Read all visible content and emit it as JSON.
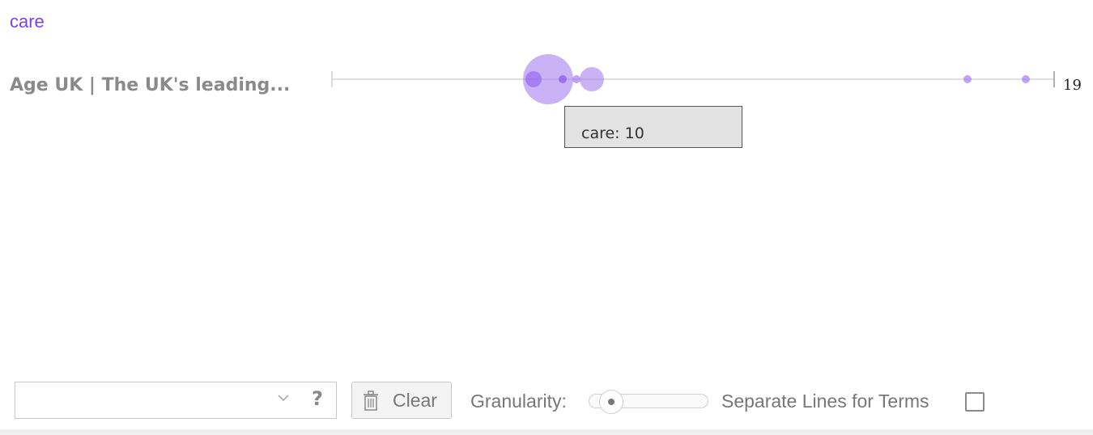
{
  "legend": {
    "term": "care",
    "term_color": "#7b3ff2"
  },
  "document": {
    "title": "Age UK | The UK's leading...",
    "segment_count": "19"
  },
  "tooltip": {
    "text": "care: 10"
  },
  "toolbar": {
    "search_value": "",
    "help_icon": "?",
    "clear_label": "Clear",
    "granularity_label": "Granularity:",
    "granularity_level": 0.1,
    "separate_lines_label": "Separate Lines for Terms",
    "separate_lines_checked": false
  },
  "colors": {
    "bubble_fill": "#a77ef2",
    "track_line": "#cfcfcf",
    "label_gray": "#8a8a8a"
  },
  "icons": [
    "chevron-down-icon",
    "help-icon",
    "trash-icon"
  ]
}
